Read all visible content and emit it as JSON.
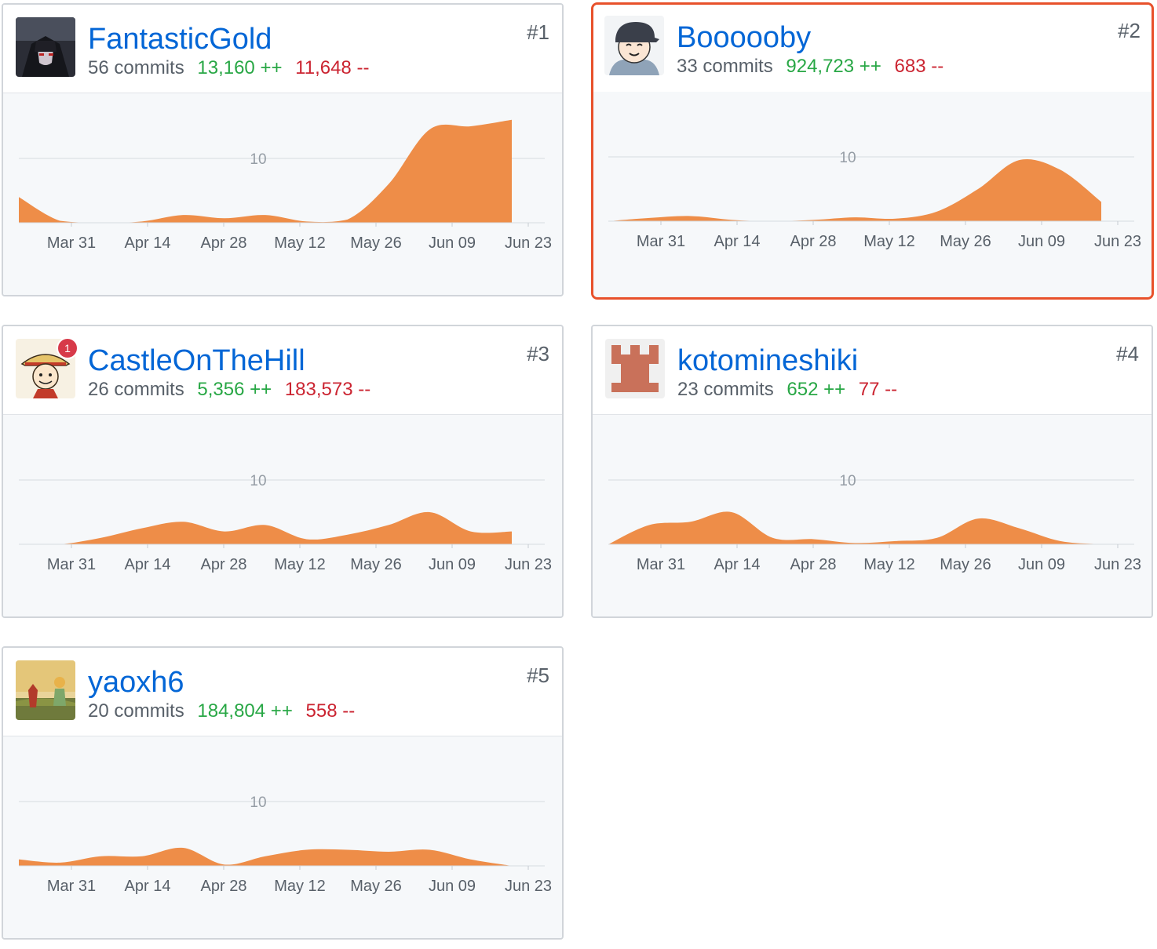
{
  "colors": {
    "link": "#0366d6",
    "additions": "#28a745",
    "deletions": "#cb2431",
    "area": "#ee8d48",
    "selection": "#e8512b"
  },
  "shared": {
    "x_ticks": [
      "Mar 31",
      "Apr 14",
      "Apr 28",
      "May 12",
      "May 26",
      "Jun 09",
      "Jun 23"
    ],
    "ref_line_label": "10"
  },
  "contributors": [
    {
      "rank": "#1",
      "username": "FantasticGold",
      "commits": "56 commits",
      "additions": "13,160 ++",
      "deletions": "11,648 --",
      "avatar_icon": "dark-anime-avatar-icon",
      "notification_count": null,
      "selected": false
    },
    {
      "rank": "#2",
      "username": "Boooooby",
      "commits": "33 commits",
      "additions": "924,723 ++",
      "deletions": "683 --",
      "avatar_icon": "cartoon-boy-cap-avatar-icon",
      "notification_count": null,
      "selected": true
    },
    {
      "rank": "#3",
      "username": "CastleOnTheHill",
      "commits": "26 commits",
      "additions": "5,356 ++",
      "deletions": "183,573 --",
      "avatar_icon": "straw-hat-sketch-avatar-icon",
      "notification_count": "1",
      "selected": false
    },
    {
      "rank": "#4",
      "username": "kotomineshiki",
      "commits": "23 commits",
      "additions": "652 ++",
      "deletions": "77 --",
      "avatar_icon": "identicon-avatar-icon",
      "notification_count": null,
      "selected": false
    },
    {
      "rank": "#5",
      "username": "yaoxh6",
      "commits": "20 commits",
      "additions": "184,804 ++",
      "deletions": "558 --",
      "avatar_icon": "little-prince-avatar-icon",
      "notification_count": null,
      "selected": false
    }
  ],
  "chart_data": [
    {
      "type": "area",
      "contributor": "FantasticGold",
      "x": [
        "Mar 24",
        "Mar 31",
        "Apr 07",
        "Apr 14",
        "Apr 21",
        "Apr 28",
        "May 05",
        "May 12",
        "May 19",
        "May 26",
        "Jun 02",
        "Jun 09",
        "Jun 16",
        "Jun 23"
      ],
      "values": [
        4,
        0.3,
        0,
        0.2,
        1.2,
        0.7,
        1.2,
        0.2,
        0.5,
        6,
        14.5,
        15,
        16
      ],
      "x_ticks": [
        "Mar 31",
        "Apr 14",
        "Apr 28",
        "May 12",
        "May 26",
        "Jun 09",
        "Jun 23"
      ],
      "reference_line": 10,
      "ylim": [
        0,
        20
      ]
    },
    {
      "type": "area",
      "contributor": "Boooooby",
      "x": [
        "Mar 24",
        "Mar 31",
        "Apr 07",
        "Apr 14",
        "Apr 21",
        "Apr 28",
        "May 05",
        "May 12",
        "May 19",
        "May 26",
        "Jun 02",
        "Jun 09",
        "Jun 16",
        "Jun 23"
      ],
      "values": [
        0,
        0.5,
        0.8,
        0.2,
        0,
        0.2,
        0.6,
        0.4,
        1.5,
        5,
        9.5,
        8,
        3
      ],
      "x_ticks": [
        "Mar 31",
        "Apr 14",
        "Apr 28",
        "May 12",
        "May 26",
        "Jun 09",
        "Jun 23"
      ],
      "reference_line": 10,
      "ylim": [
        0,
        20
      ]
    },
    {
      "type": "area",
      "contributor": "CastleOnTheHill",
      "x": [
        "Mar 24",
        "Mar 31",
        "Apr 07",
        "Apr 14",
        "Apr 21",
        "Apr 28",
        "May 05",
        "May 12",
        "May 19",
        "May 26",
        "Jun 02",
        "Jun 09",
        "Jun 16",
        "Jun 23"
      ],
      "values": [
        0,
        0,
        1,
        2.5,
        3.5,
        2,
        3,
        0.8,
        1.5,
        3,
        5,
        2,
        2
      ],
      "x_ticks": [
        "Mar 31",
        "Apr 14",
        "Apr 28",
        "May 12",
        "May 26",
        "Jun 09",
        "Jun 23"
      ],
      "reference_line": 10,
      "ylim": [
        0,
        20
      ]
    },
    {
      "type": "area",
      "contributor": "kotomineshiki",
      "x": [
        "Mar 24",
        "Mar 31",
        "Apr 07",
        "Apr 14",
        "Apr 21",
        "Apr 28",
        "May 05",
        "May 12",
        "May 19",
        "May 26",
        "Jun 02",
        "Jun 09",
        "Jun 16",
        "Jun 23"
      ],
      "values": [
        0,
        3,
        3.5,
        5,
        1,
        0.8,
        0.2,
        0.5,
        1,
        4,
        2.5,
        0.5,
        0
      ],
      "x_ticks": [
        "Mar 31",
        "Apr 14",
        "Apr 28",
        "May 12",
        "May 26",
        "Jun 09",
        "Jun 23"
      ],
      "reference_line": 10,
      "ylim": [
        0,
        20
      ]
    },
    {
      "type": "area",
      "contributor": "yaoxh6",
      "x": [
        "Mar 24",
        "Mar 31",
        "Apr 07",
        "Apr 14",
        "Apr 21",
        "Apr 28",
        "May 05",
        "May 12",
        "May 19",
        "May 26",
        "Jun 02",
        "Jun 09",
        "Jun 16",
        "Jun 23"
      ],
      "values": [
        1,
        0.5,
        1.5,
        1.5,
        2.8,
        0.2,
        1.5,
        2.5,
        2.5,
        2.2,
        2.5,
        1,
        0
      ],
      "x_ticks": [
        "Mar 31",
        "Apr 14",
        "Apr 28",
        "May 12",
        "May 26",
        "Jun 09",
        "Jun 23"
      ],
      "reference_line": 10,
      "ylim": [
        0,
        20
      ]
    }
  ]
}
